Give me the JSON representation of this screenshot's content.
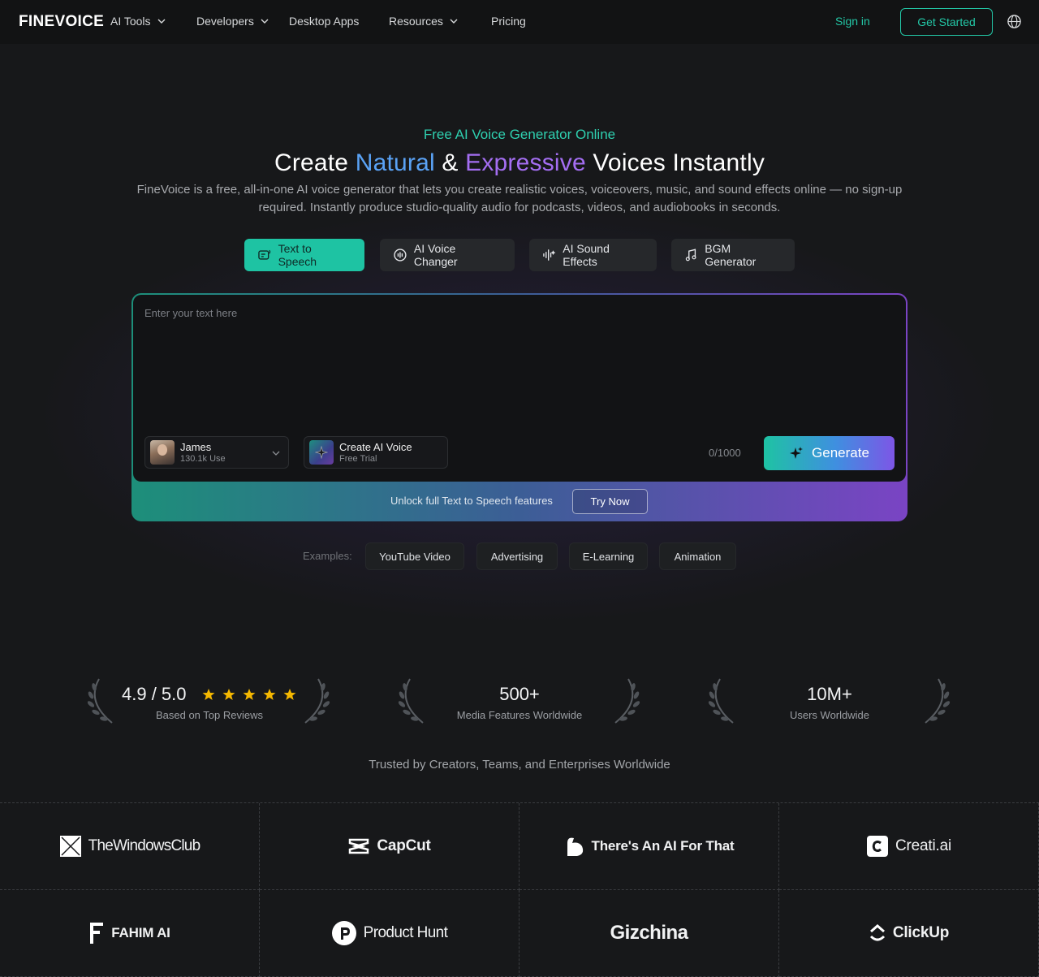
{
  "nav": {
    "logo": "FINEVOICE",
    "items": [
      {
        "label": "AI Tools",
        "dropdown": true
      },
      {
        "label": "Developers",
        "dropdown": true
      },
      {
        "label": "Desktop Apps",
        "dropdown": false
      },
      {
        "label": "Resources",
        "dropdown": true
      },
      {
        "label": "Pricing",
        "dropdown": false
      }
    ],
    "sign_in": "Sign in",
    "get_started": "Get Started",
    "language_icon": "globe-icon"
  },
  "hero": {
    "eyebrow": "Free AI Voice Generator Online",
    "headline": {
      "part1": "Create ",
      "word_blue": "Natural",
      "part2": " & ",
      "word_purple": "Expressive",
      "part3": " Voices Instantly"
    },
    "description": "FineVoice is a free, all-in-one AI voice generator that lets you create realistic voices, voiceovers, music, and sound effects online — no sign-up required. Instantly produce studio-quality audio for podcasts, videos, and audiobooks in seconds."
  },
  "tabs": [
    {
      "label": "Text to Speech",
      "icon": "text-to-speech-icon",
      "active": true
    },
    {
      "label": "AI Voice Changer",
      "icon": "voice-changer-icon",
      "active": false
    },
    {
      "label": "AI Sound Effects",
      "icon": "sound-waves-icon",
      "active": false
    },
    {
      "label": "BGM Generator",
      "icon": "music-note-icon",
      "active": false
    }
  ],
  "editor": {
    "placeholder": "Enter your text here",
    "voice": {
      "name": "James",
      "usage": "130.1k Use"
    },
    "create_voice": {
      "title": "Create AI Voice",
      "subtitle": "Free Trial"
    },
    "char_count": "0/1000",
    "generate_label": "Generate",
    "unlock_text": "Unlock full Text to Speech features",
    "try_now": "Try Now"
  },
  "examples": {
    "label": "Examples:",
    "chips": [
      "YouTube Video",
      "Advertising",
      "E-Learning",
      "Animation"
    ]
  },
  "stats": [
    {
      "value": "4.9 / 5.0",
      "label": "Based on Top Reviews",
      "rating": 5
    },
    {
      "value": "500+",
      "label": "Media Features Worldwide"
    },
    {
      "value": "10M+",
      "label": "Users Worldwide"
    }
  ],
  "trusted_heading": "Trusted by Creators, Teams, and Enterprises Worldwide",
  "brands": [
    "TheWindowsClub",
    "CapCut",
    "There's An AI For That",
    "Creati.ai",
    "FAHIM AI",
    "Product Hunt",
    "Gizchina",
    "ClickUp"
  ],
  "colors": {
    "accent": "#1ec3a3",
    "brand_blue": "#5aa2f5",
    "brand_purple": "#a46ef2",
    "star": "#f5b800",
    "background": "#17181a"
  }
}
